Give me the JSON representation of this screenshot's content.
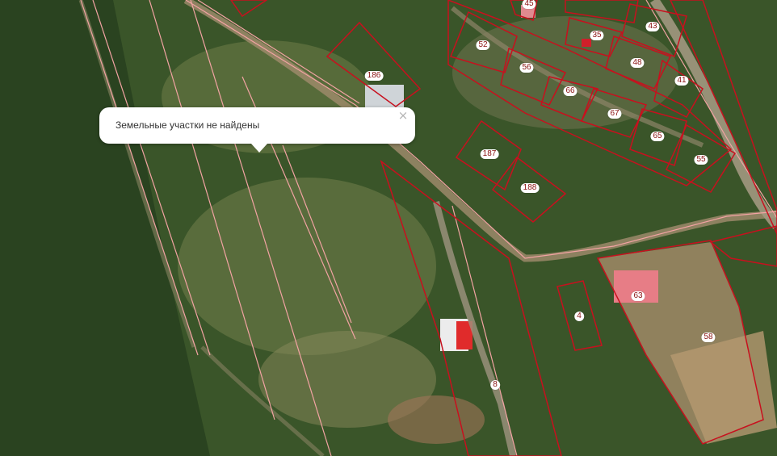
{
  "popup": {
    "message": "Земельные участки не найдены",
    "close_icon": "close-icon",
    "close_glyph": "×"
  },
  "parcels": [
    {
      "id": "p45",
      "label": "45"
    },
    {
      "id": "p43",
      "label": "43"
    },
    {
      "id": "p35",
      "label": "35"
    },
    {
      "id": "p52",
      "label": "52"
    },
    {
      "id": "p48",
      "label": "48"
    },
    {
      "id": "p56",
      "label": "56"
    },
    {
      "id": "p41",
      "label": "41"
    },
    {
      "id": "p186",
      "label": "186"
    },
    {
      "id": "p66",
      "label": "66"
    },
    {
      "id": "p67",
      "label": "67"
    },
    {
      "id": "p65",
      "label": "65"
    },
    {
      "id": "p187",
      "label": "187"
    },
    {
      "id": "p55",
      "label": "55"
    },
    {
      "id": "p188",
      "label": "188"
    },
    {
      "id": "p63",
      "label": "63"
    },
    {
      "id": "p4",
      "label": "4"
    },
    {
      "id": "p58",
      "label": "58"
    },
    {
      "id": "p8",
      "label": "8"
    }
  ],
  "colors": {
    "parcel_border": "#c8101e",
    "parcel_label_text": "#8a1212",
    "road_line": "#f2a3a3",
    "forest": "#2f4a22"
  }
}
